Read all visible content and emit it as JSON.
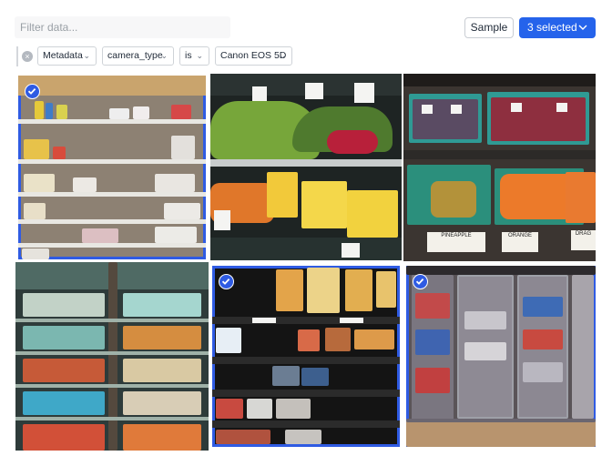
{
  "toolbar": {
    "filter_placeholder": "Filter data...",
    "sample_label": "Sample",
    "selected_label": "3 selected"
  },
  "filter": {
    "field": "Metadata",
    "key": "camera_type",
    "operator": "is",
    "value": "Canon EOS 5D"
  },
  "gallery": {
    "images": [
      {
        "subject": "grocery shelves",
        "selected": true
      },
      {
        "subject": "produce display",
        "selected": false
      },
      {
        "subject": "fruit bins",
        "selected": false,
        "sign_1": "PINEAPPLE",
        "sign_2": "ORANGE",
        "sign_3": "DRAG"
      },
      {
        "subject": "beverage cooler",
        "selected": false
      },
      {
        "subject": "canned goods",
        "selected": true
      },
      {
        "subject": "convenience cooler",
        "selected": true
      }
    ]
  },
  "colors": {
    "accent": "#2563eb",
    "selection_border": "#2f5be3"
  }
}
